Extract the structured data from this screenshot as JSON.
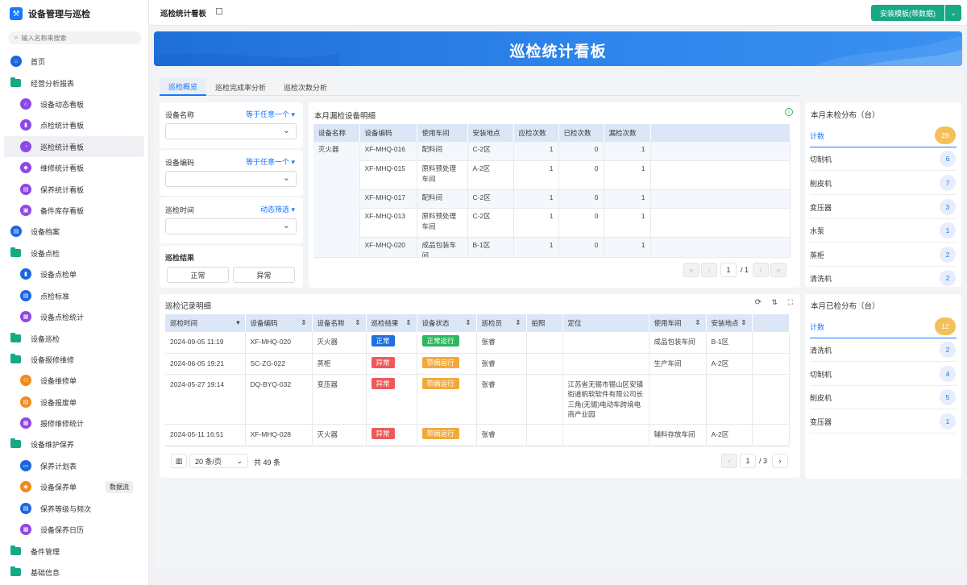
{
  "app": {
    "title": "设备管理与巡检"
  },
  "search": {
    "placeholder": "输入名称来搜索"
  },
  "sidebar": {
    "items": [
      {
        "label": "首页"
      },
      {
        "label": "经营分析报表"
      },
      {
        "label": "设备动态看板"
      },
      {
        "label": "点检统计看板"
      },
      {
        "label": "巡检统计看板"
      },
      {
        "label": "维修统计看板"
      },
      {
        "label": "保养统计看板"
      },
      {
        "label": "备件库存看板"
      },
      {
        "label": "设备档案"
      },
      {
        "label": "设备点检"
      },
      {
        "label": "设备点检单"
      },
      {
        "label": "点检标准"
      },
      {
        "label": "设备点检统计"
      },
      {
        "label": "设备巡检"
      },
      {
        "label": "设备报修维修"
      },
      {
        "label": "设备维修单"
      },
      {
        "label": "设备报废单"
      },
      {
        "label": "报修维修统计"
      },
      {
        "label": "设备维护保养"
      },
      {
        "label": "保养计划表"
      },
      {
        "label": "设备保养单",
        "tag": "数据流"
      },
      {
        "label": "保养等级与频次"
      },
      {
        "label": "设备保养日历"
      },
      {
        "label": "备件管理"
      },
      {
        "label": "基础信息"
      }
    ]
  },
  "topbar": {
    "tab": "巡检统计看板",
    "install_button": "安装模板(带数据)"
  },
  "banner": {
    "title": "巡检统计看板"
  },
  "tabs": [
    "巡检概览",
    "巡检完成率分析",
    "巡检次数分析"
  ],
  "filters": {
    "device_name": {
      "label": "设备名称",
      "mode": "等于任意一个"
    },
    "device_code": {
      "label": "设备编码",
      "mode": "等于任意一个"
    },
    "time": {
      "label": "巡检时间",
      "mode": "动态筛选"
    },
    "result": {
      "label": "巡检结果",
      "options": [
        "正常",
        "异常"
      ]
    }
  },
  "missed": {
    "title": "本月漏检设备明细",
    "columns": [
      "设备名称",
      "设备编码",
      "使用车间",
      "安装地点",
      "应检次数",
      "已检次数",
      "漏检次数"
    ],
    "group": "灭火器",
    "rows": [
      {
        "code": "XF-MHQ-016",
        "workshop": "配料间",
        "location": "C-2区",
        "due": "1",
        "done": "0",
        "missed": "1"
      },
      {
        "code": "XF-MHQ-015",
        "workshop": "原料预处理车间",
        "location": "A-2区",
        "due": "1",
        "done": "0",
        "missed": "1"
      },
      {
        "code": "XF-MHQ-017",
        "workshop": "配料间",
        "location": "C-2区",
        "due": "1",
        "done": "0",
        "missed": "1"
      },
      {
        "code": "XF-MHQ-013",
        "workshop": "原料预处理车间",
        "location": "C-2区",
        "due": "1",
        "done": "0",
        "missed": "1"
      },
      {
        "code": "XF-MHQ-020",
        "workshop": "成品包装车间",
        "location": "B-1区",
        "due": "1",
        "done": "0",
        "missed": "1"
      }
    ],
    "page": "1",
    "total_pages": "/ 1"
  },
  "records": {
    "title": "巡检记录明细",
    "columns": [
      "巡检时间",
      "设备编码",
      "设备名称",
      "巡检结果",
      "设备状态",
      "巡检员",
      "拍照",
      "定位",
      "使用车间",
      "安装地点"
    ],
    "rows": [
      {
        "time": "2024-09-05 11:19",
        "code": "XF-MHQ-020",
        "name": "灭火器",
        "result": "正常",
        "result_color": "blue",
        "status": "正常运行",
        "status_color": "green",
        "inspector": "张睿",
        "location_text": "",
        "workshop": "成品包装车间",
        "place": "B-1区"
      },
      {
        "time": "2024-06-05 19:21",
        "code": "SC-ZG-022",
        "name": "蒸柜",
        "result": "异常",
        "result_color": "red",
        "status": "带病运行",
        "status_color": "orange",
        "inspector": "张睿",
        "location_text": "",
        "workshop": "生产车间",
        "place": "A-2区"
      },
      {
        "time": "2024-05-27 19:14",
        "code": "DQ-BYQ-032",
        "name": "变压器",
        "result": "异常",
        "result_color": "red",
        "status": "带病运行",
        "status_color": "orange",
        "inspector": "张睿",
        "location_text": "江苏省无锡市锡山区安镇街道帆软软件有限公司长三角(无锡)电动车跨境电商产业园",
        "workshop": "",
        "place": ""
      },
      {
        "time": "2024-05-11 16:51",
        "code": "XF-MHQ-028",
        "name": "灭火器",
        "result": "异常",
        "result_color": "red",
        "status": "带病运行",
        "status_color": "orange",
        "inspector": "张睿",
        "location_text": "",
        "workshop": "辅料存放车间",
        "place": "A-2区"
      }
    ],
    "page_size": "20 条/页",
    "total": "共 49 条",
    "page": "1",
    "total_pages": "/ 3"
  },
  "unchecked": {
    "title": "本月未检分布（台）",
    "head": {
      "label": "计数",
      "count": "29"
    },
    "rows": [
      {
        "label": "切制机",
        "count": "6"
      },
      {
        "label": "削皮机",
        "count": "7"
      },
      {
        "label": "变压器",
        "count": "3"
      },
      {
        "label": "水泵",
        "count": "1"
      },
      {
        "label": "蒸柜",
        "count": "2"
      },
      {
        "label": "清洗机",
        "count": "2"
      }
    ]
  },
  "checked": {
    "title": "本月已检分布（台）",
    "head": {
      "label": "计数",
      "count": "12"
    },
    "rows": [
      {
        "label": "清洗机",
        "count": "2"
      },
      {
        "label": "切制机",
        "count": "4"
      },
      {
        "label": "削皮机",
        "count": "5"
      },
      {
        "label": "变压器",
        "count": "1"
      }
    ]
  }
}
